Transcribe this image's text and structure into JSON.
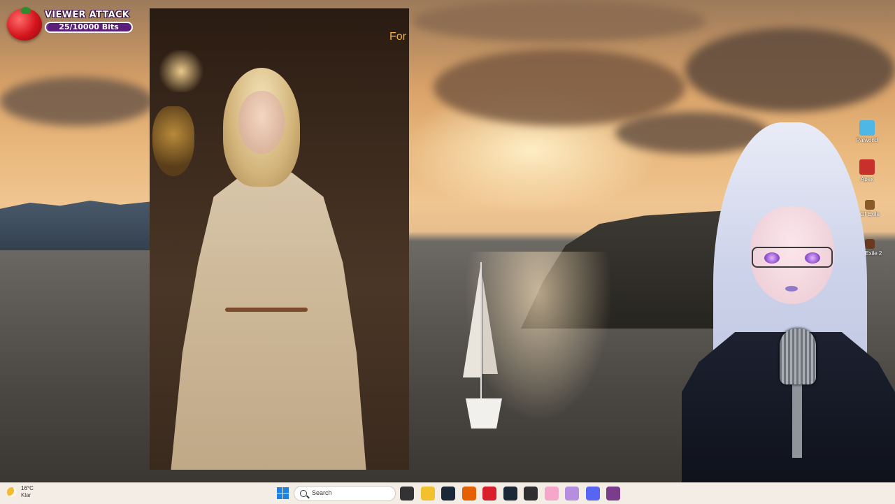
{
  "overlay": {
    "viewer_attack": {
      "title": "VIEWER ATTACK",
      "progress_text": "25/10000 Bits",
      "current": 25,
      "goal": 10000,
      "accent": "#8b3bb5"
    }
  },
  "video": {
    "caption": "For"
  },
  "desktop_icons": [
    {
      "label": "Palworld",
      "icon": "palworld-icon"
    },
    {
      "label": "Apex",
      "icon": "apex-icon"
    },
    {
      "label": "Of Exile",
      "icon": "path-of-exile-icon"
    },
    {
      "label": "Of Exile 2",
      "icon": "path-of-exile-2-icon"
    }
  ],
  "taskbar": {
    "weather": {
      "temp": "16°C",
      "desc": "Klar",
      "icon": "moon-icon"
    },
    "search_placeholder": "Search",
    "apps": [
      {
        "name": "task-view",
        "color": "#333333"
      },
      {
        "name": "file-explorer",
        "color": "#f2c12e"
      },
      {
        "name": "steam",
        "color": "#1b2838"
      },
      {
        "name": "firefox",
        "color": "#e66000"
      },
      {
        "name": "opera",
        "color": "#d91f2b"
      },
      {
        "name": "steam-2",
        "color": "#1b2838"
      },
      {
        "name": "obs",
        "color": "#302e31"
      },
      {
        "name": "vtube-studio",
        "color": "#f6a6c8"
      },
      {
        "name": "game-app",
        "color": "#b58ee0"
      },
      {
        "name": "discord",
        "color": "#5865f2"
      },
      {
        "name": "active-app",
        "color": "#7a3d8c"
      }
    ],
    "accent": "#1e82e0"
  }
}
